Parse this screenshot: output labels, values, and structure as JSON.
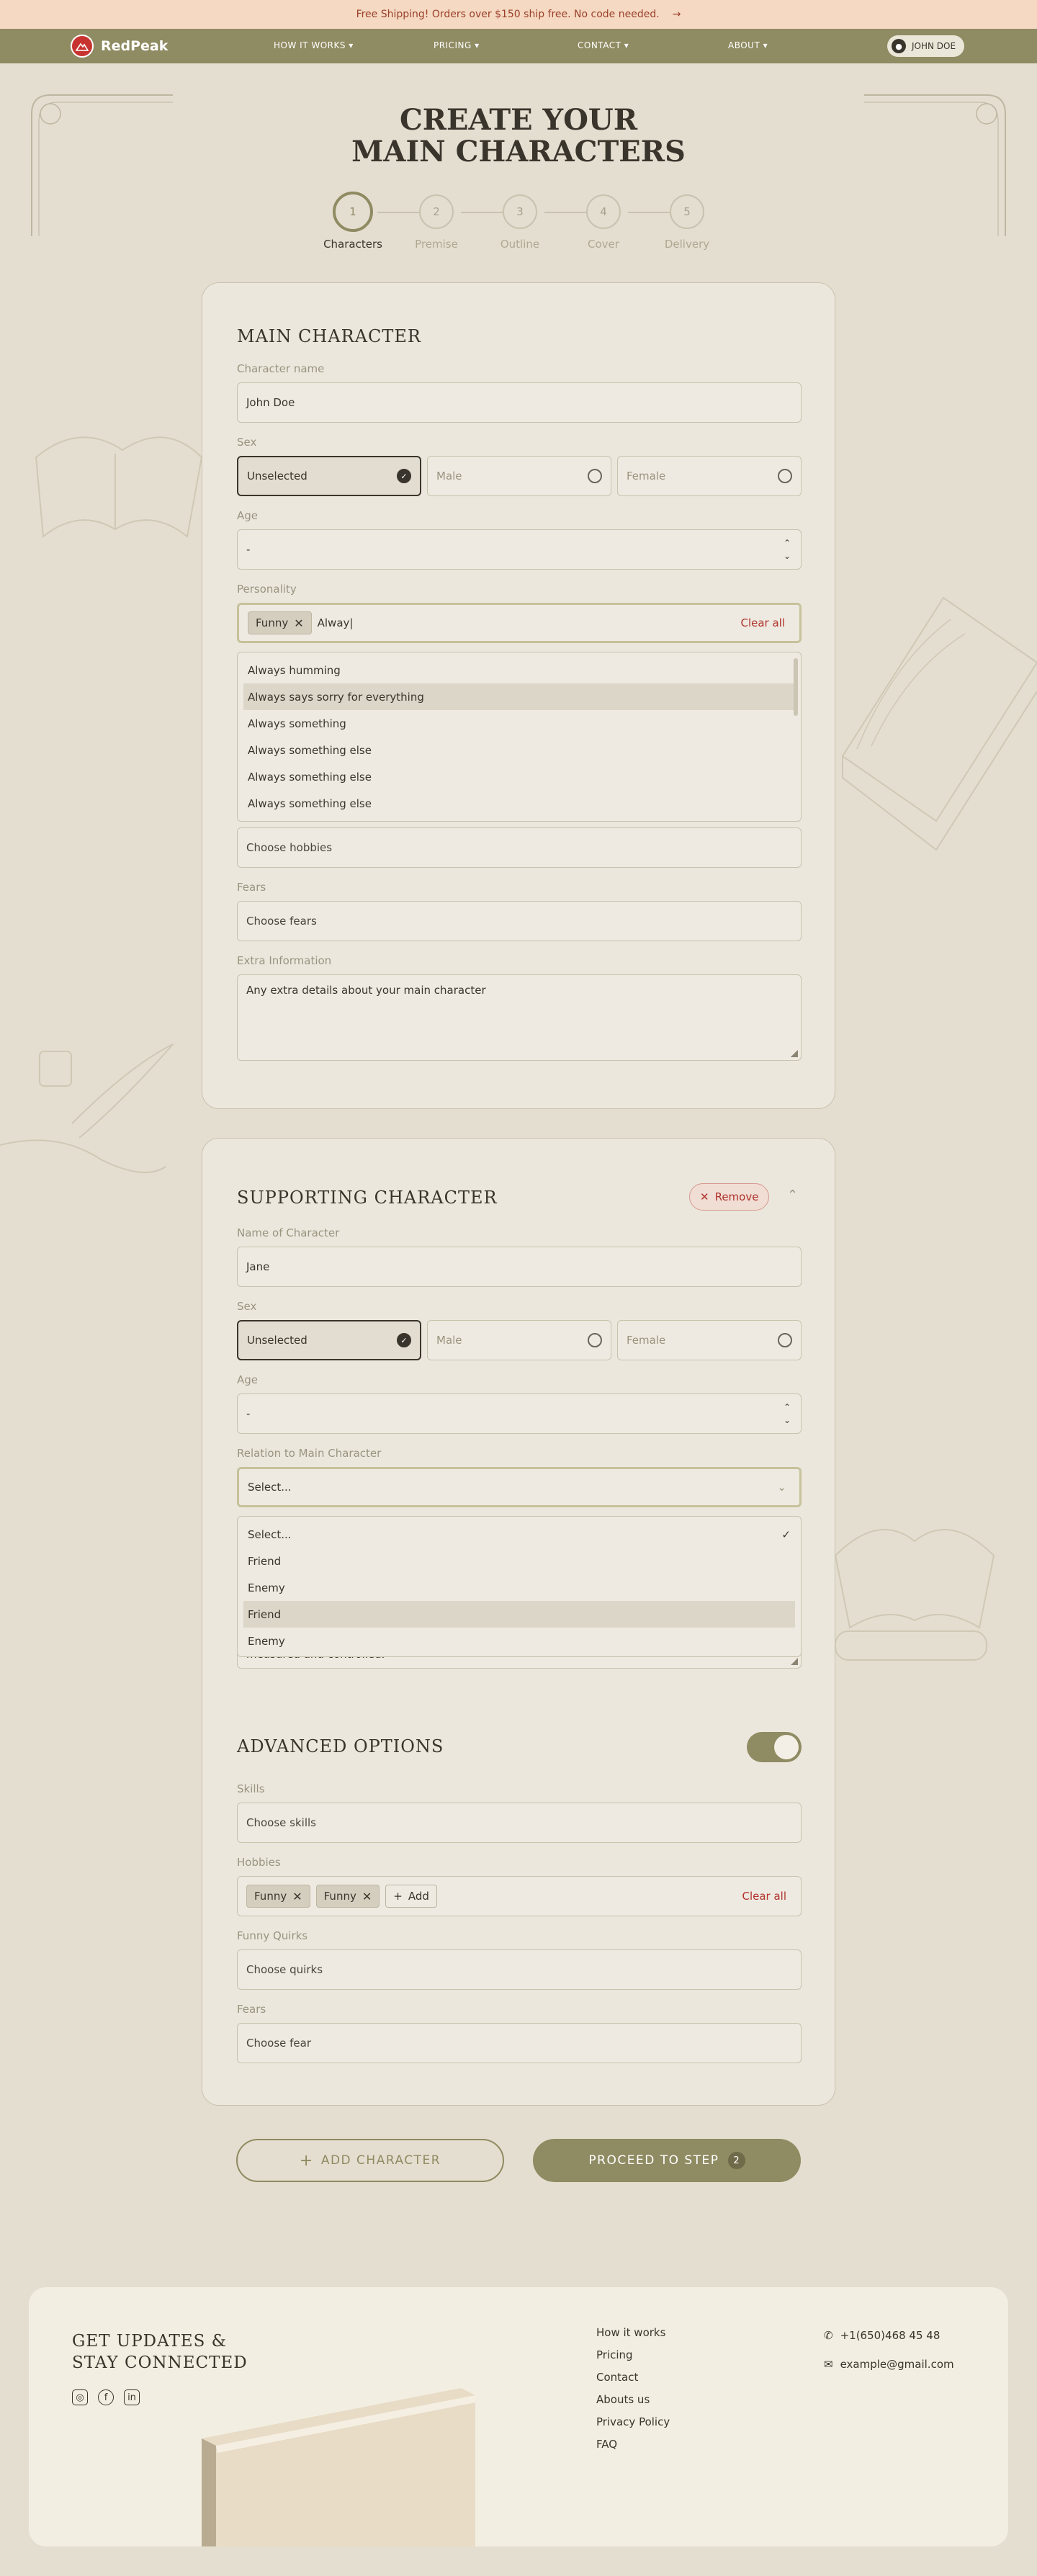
{
  "promo": {
    "text": "Free Shipping! Orders over $150 ship free. No code needed.",
    "arrow": "→"
  },
  "nav": {
    "brand": "RedPeak",
    "items": [
      "HOW IT WORKS",
      "PRICING",
      "CONTACT",
      "ABOUT"
    ],
    "user": "JOHN DOE"
  },
  "page": {
    "title_line1": "CREATE YOUR",
    "title_line2": "MAIN CHARACTERS"
  },
  "stepper": {
    "steps": [
      {
        "num": "1",
        "label": "Characters"
      },
      {
        "num": "2",
        "label": "Premise"
      },
      {
        "num": "3",
        "label": "Outline"
      },
      {
        "num": "4",
        "label": "Cover"
      },
      {
        "num": "5",
        "label": "Delivery"
      }
    ],
    "active_step": 1
  },
  "main_character": {
    "heading": "MAIN CHARACTER",
    "name_label": "Character name",
    "name_value": "John Doe",
    "sex_label": "Sex",
    "sex_options": [
      "Unselected",
      "Male",
      "Female"
    ],
    "sex_selected": "Unselected",
    "age_label": "Age",
    "age_value": "-",
    "personality_label": "Personality",
    "personality_chip": "Funny",
    "personality_input": "Alway|",
    "clear_all": "Clear all",
    "suggestions": [
      "Always humming",
      "Always says sorry for everything",
      "Always something",
      "Always something else",
      "Always something else",
      "Always something else"
    ],
    "hobbies_placeholder": "Choose hobbies",
    "fears_label": "Fears",
    "fears_placeholder": "Choose fears",
    "extra_label": "Extra Information",
    "extra_placeholder": "Any extra details about your main character"
  },
  "supporting_character": {
    "heading": "SUPPORTING CHARACTER",
    "remove_label": "Remove",
    "name_label": "Name of Character",
    "name_value": "Jane",
    "sex_label": "Sex",
    "sex_options": [
      "Unselected",
      "Male",
      "Female"
    ],
    "age_label": "Age",
    "age_value": "-",
    "relation_label": "Relation to Main Character",
    "relation_value": "Select...",
    "relation_options": [
      "Select...",
      "Friend",
      "Enemy",
      "Friend",
      "Enemy"
    ],
    "textarea_tail": "measured and controlled."
  },
  "advanced": {
    "heading": "ADVANCED OPTIONS",
    "toggle_on": true,
    "skills_label": "Skills",
    "skills_placeholder": "Choose skills",
    "hobbies_label": "Hobbies",
    "hobbies_chips": [
      "Funny",
      "Funny"
    ],
    "add_label": "Add",
    "clear_all": "Clear all",
    "quirks_label": "Funny Quirks",
    "quirks_placeholder": "Choose quirks",
    "fears_label": "Fears",
    "fears_placeholder": "Choose fear"
  },
  "actions": {
    "add_character": "ADD CHARACTER",
    "proceed": "PROCEED TO STEP",
    "proceed_step": "2"
  },
  "footer": {
    "heading_line1": "GET UPDATES &",
    "heading_line2": "STAY CONNECTED",
    "links": [
      "How it works",
      "Pricing",
      "Contact",
      "Abouts us",
      "Privacy Policy",
      "FAQ"
    ],
    "phone": "+1(650)468 45 48",
    "email": "example@gmail.com"
  },
  "colors": {
    "accent": "#8f8b62",
    "danger": "#b0322c",
    "background": "#e4ded0",
    "promo_bg": "#f5d9c2"
  }
}
